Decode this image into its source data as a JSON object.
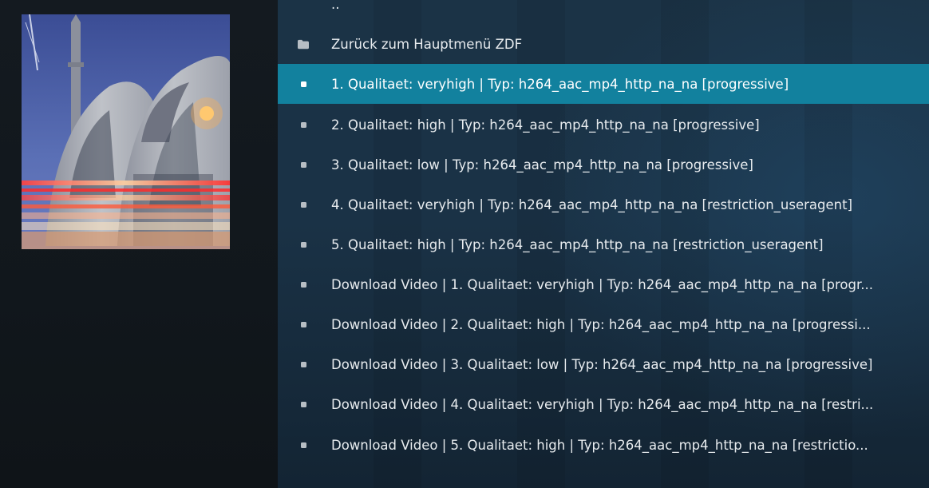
{
  "list": {
    "items": [
      {
        "label": "..",
        "icon": "none"
      },
      {
        "label": "Zurück zum Hauptmenü ZDF",
        "icon": "folder-icon"
      },
      {
        "label": "1. Qualitaet: veryhigh | Typ: h264_aac_mp4_http_na_na [progressive]",
        "icon": "bullet-icon",
        "selected": true
      },
      {
        "label": "2. Qualitaet: high | Typ: h264_aac_mp4_http_na_na [progressive]",
        "icon": "bullet-icon"
      },
      {
        "label": "3. Qualitaet: low | Typ: h264_aac_mp4_http_na_na [progressive]",
        "icon": "bullet-icon"
      },
      {
        "label": "4. Qualitaet: veryhigh | Typ: h264_aac_mp4_http_na_na [restriction_useragent]",
        "icon": "bullet-icon"
      },
      {
        "label": "5. Qualitaet: high | Typ: h264_aac_mp4_http_na_na [restriction_useragent]",
        "icon": "bullet-icon"
      },
      {
        "label": "Download Video  | 1. Qualitaet: veryhigh | Typ: h264_aac_mp4_http_na_na [progr...",
        "icon": "bullet-icon"
      },
      {
        "label": "Download Video  | 2. Qualitaet: high | Typ: h264_aac_mp4_http_na_na [progressi...",
        "icon": "bullet-icon"
      },
      {
        "label": "Download Video  | 3. Qualitaet: low | Typ: h264_aac_mp4_http_na_na [progressive]",
        "icon": "bullet-icon"
      },
      {
        "label": "Download Video  | 4. Qualitaet: veryhigh | Typ: h264_aac_mp4_http_na_na [restri...",
        "icon": "bullet-icon"
      },
      {
        "label": "Download Video  | 5. Qualitaet: high | Typ: h264_aac_mp4_http_na_na [restrictio...",
        "icon": "bullet-icon"
      }
    ]
  },
  "colors": {
    "selected_row": "#12819e",
    "text": "#e8ecef",
    "background_left": "#11161b",
    "background_right": "#1b3346"
  }
}
